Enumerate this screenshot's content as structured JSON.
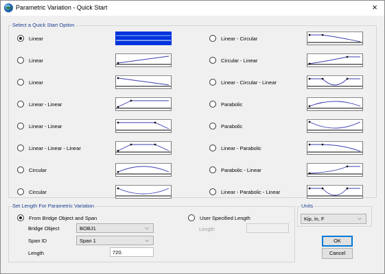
{
  "window": {
    "title": "Parametric Variation - Quick Start",
    "close": "×"
  },
  "quick_start": {
    "group_title": "Select a Quick Start Option",
    "options": [
      {
        "label": "Linear",
        "selected": true,
        "curve": "flat-line"
      },
      {
        "label": "Linear",
        "selected": false,
        "curve": "rise"
      },
      {
        "label": "Linear",
        "selected": false,
        "curve": "fall"
      },
      {
        "label": "Linear - Linear",
        "selected": false,
        "curve": "rise-flat"
      },
      {
        "label": "Linear - Linear",
        "selected": false,
        "curve": "flat-fall"
      },
      {
        "label": "Linear - Linear - Linear",
        "selected": false,
        "curve": "trapezoid"
      },
      {
        "label": "Circular",
        "selected": false,
        "curve": "arc-up"
      },
      {
        "label": "Circular",
        "selected": false,
        "curve": "arc-down"
      },
      {
        "label": "Linear - Circular",
        "selected": false,
        "curve": "flat-arc-fall"
      },
      {
        "label": "Circular - Linear",
        "selected": false,
        "curve": "arc-rise-flat"
      },
      {
        "label": "Linear - Circular - Linear",
        "selected": false,
        "curve": "flat-dip-flat"
      },
      {
        "label": "Parabolic",
        "selected": false,
        "curve": "parab-up"
      },
      {
        "label": "Parabolic",
        "selected": false,
        "curve": "parab-down"
      },
      {
        "label": "Linear - Parabolic",
        "selected": false,
        "curve": "flat-parab-fall"
      },
      {
        "label": "Parabolic - Linear",
        "selected": false,
        "curve": "parab-rise-flat"
      },
      {
        "label": "Linear - Parabolic - Linear",
        "selected": false,
        "curve": "flat-pdip-flat"
      }
    ]
  },
  "set_length": {
    "group_title": "Set Length For Parametric Variation",
    "from_bridge_label": "From Bridge Object and Span",
    "user_specified_label": "User Specified Length",
    "bridge_object_label": "Bridge Object",
    "bridge_object_value": "BOBJ1",
    "span_id_label": "Span ID",
    "span_id_value": "Span 1",
    "length_label": "Length",
    "length_value": "720.",
    "user_length_label": "Length",
    "user_length_value": ""
  },
  "units": {
    "group_title": "Units",
    "value": "Kip, in, F"
  },
  "buttons": {
    "ok": "OK",
    "cancel": "Cancel"
  },
  "colors": {
    "accent_blue": "#0033dd",
    "curve": "#3b3bb0",
    "group_title": "#1b3d8f"
  }
}
